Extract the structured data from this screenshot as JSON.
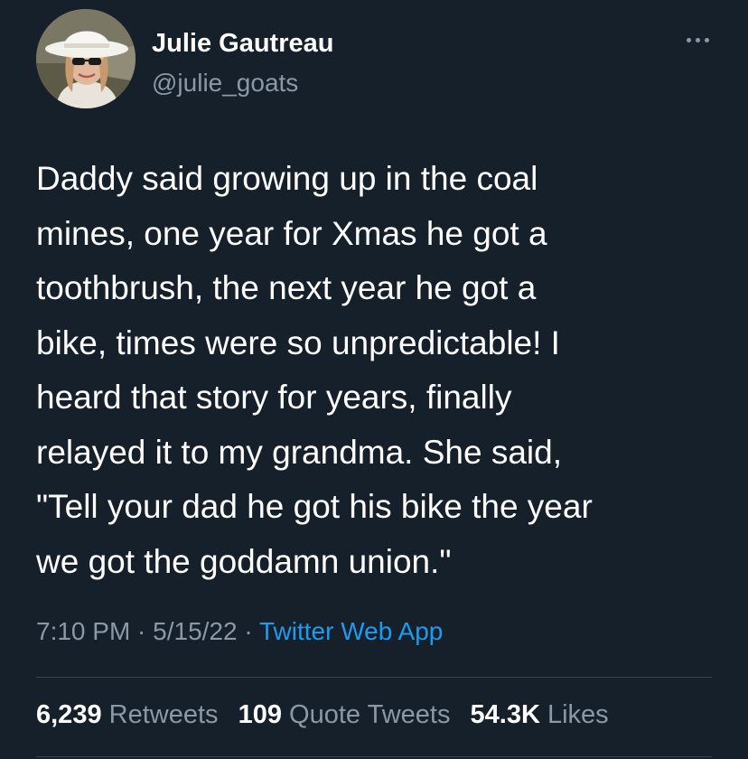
{
  "user": {
    "display_name": "Julie Gautreau",
    "handle": "@julie_goats",
    "avatar_icon": "profile-photo-icon"
  },
  "menu": {
    "more_icon": "ellipsis-icon"
  },
  "tweet": {
    "text": "Daddy said growing up in the coal\nmines, one year for Xmas he got a\ntoothbrush, the next year he got a\nbike, times were so unpredictable! I\nheard that story for years, finally\nrelayed it to my grandma. She said,\n\"Tell your dad he got his bike the year\nwe got the goddamn union.\""
  },
  "meta": {
    "time": "7:10 PM",
    "sep1": " · ",
    "date": "5/15/22",
    "sep2": " · ",
    "source": "Twitter Web App"
  },
  "stats": {
    "retweets_count": "6,239",
    "retweets_label": "Retweets",
    "quotes_count": "109",
    "quotes_label": "Quote Tweets",
    "likes_count": "54.3K",
    "likes_label": "Likes"
  },
  "colors": {
    "background": "#15202b",
    "text": "#ffffff",
    "secondary": "#8b98a5",
    "link": "#1d9bf0",
    "divider": "#38444d"
  }
}
